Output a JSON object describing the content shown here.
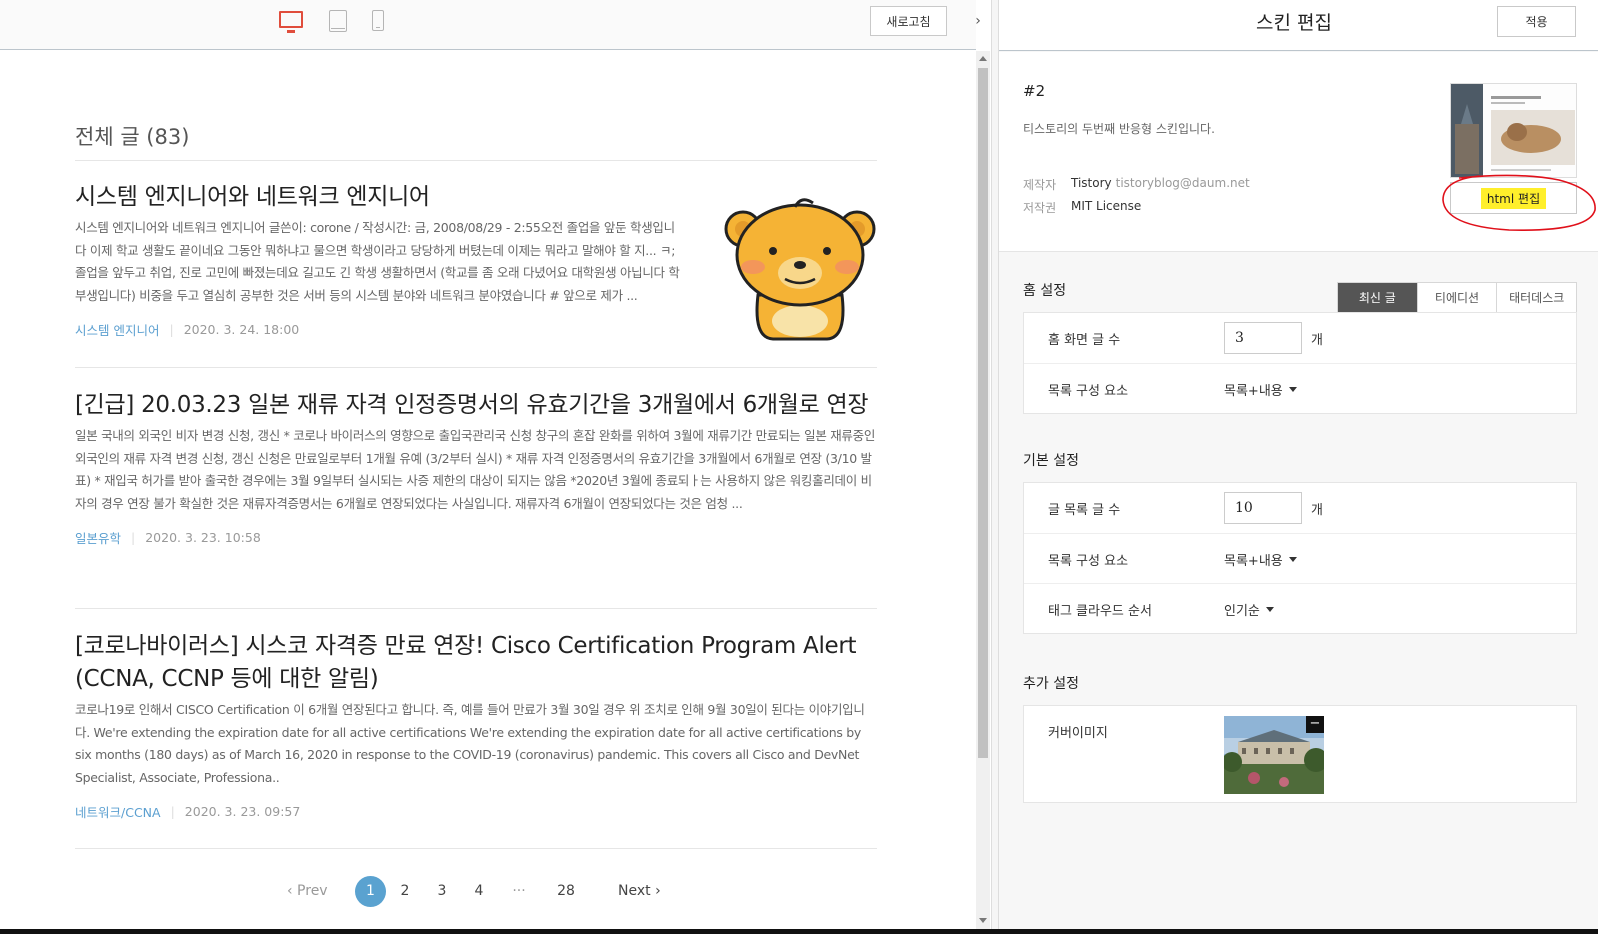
{
  "preview": {
    "toolbar": {
      "refresh_label": "새로고침",
      "collapse_glyph": "›"
    },
    "blog_title": "전체 글 (83)",
    "posts": [
      {
        "title": "시스템 엔지니어와 네트워크 엔지니어",
        "excerpt": "시스템 엔지니어와 네트워크 엔지니어 글쓴이: corone / 작성시간: 금, 2008/08/29 - 2:55오전 졸업을 앞둔 학생입니다 이제 학교 생활도 끝이네요 그동안 뭐하냐고 물으면 학생이라고 당당하게 버텼는데 이제는 뭐라고 말해야 할 지... ㅋ; 졸업을 앞두고 취업, 진로 고민에 빠졌는데요 길고도 긴 학생 생활하면서 (학교를 좀 오래 다녔어요 대학원생 아닙니다 학부생입니다) 비중을 두고 열심히 공부한 것은 서버 등의 시스템 분야와 네트워크 분야였습니다 # 앞으로 제가 ...",
        "category": "시스템 엔지니어",
        "date": "2020. 3. 24. 18:00"
      },
      {
        "title": "[긴급] 20.03.23 일본 재류 자격 인정증명서의 유효기간을 3개월에서 6개월로 연장",
        "excerpt": "일본 국내의 외국인 비자 변경 신청, 갱신 * 코로나 바이러스의 영향으로 출입국관리국 신청 창구의 혼잡 완화를 위하여 3월에 재류기간 만료되는 일본 재류중인 외국인의 재류 자격 변경 신청, 갱신 신청은 만료일로부터 1개월 유예 (3/2부터 실시) * 재류 자격 인정증명서의 유효기간을 3개월에서 6개월로 연장 (3/10 발표) * 재입국 허가를 받아 출국한 경우에는 3월 9일부터 실시되는 사증 제한의 대상이 되지는 않음 *2020년 3월에 종료되ㅏ는 사용하지 않은 워킹홀리데이 비자의 경우 연장 불가 확실한 것은 재류자격증명서는 6개월로 연장되었다는 사실입니다. 재류자격 6개월이 연장되었다는 것은 엄청 ...",
        "category": "일본유학",
        "date": "2020. 3. 23. 10:58"
      },
      {
        "title": "[코로나바이러스] 시스코 자격증 만료 연장! Cisco Certification Program Alert (CCNA, CCNP 등에 대한 알림)",
        "excerpt": "코로나19로 인해서 CISCO Certification 이 6개월 연장된다고 합니다. 즉, 예를 들어 만료가 3월 30일 경우 위 조치로 인해 9월 30일이 된다는 이야기입니다. We're extending the expiration date for all active certifications We're extending the expiration date for all active certifications by six months (180 days) as of March 16, 2020 in response to the COVID-19 (coronavirus) pandemic. This covers all Cisco and DevNet Specialist, Associate, Professiona..",
        "category": "네트워크/CCNA",
        "date": "2020. 3. 23. 09:57"
      }
    ],
    "pagination": {
      "prev": "‹ Prev",
      "next": "Next ›",
      "pages": [
        "1",
        "2",
        "3",
        "4",
        "···",
        "28"
      ],
      "current": "1"
    }
  },
  "editor": {
    "title": "스킨 편집",
    "apply_label": "적용",
    "skin": {
      "name": "#2",
      "description": "티스토리의 두번째 반응형 스킨입니다.",
      "maker_label": "제작자",
      "maker_name": "Tistory",
      "maker_email": "tistoryblog@daum.net",
      "license_label": "저작권",
      "license_value": "MIT License",
      "html_edit_label": "html 편집"
    },
    "home": {
      "title": "홈 설정",
      "tabs": [
        "최신 글",
        "티에디션",
        "태터데스크"
      ],
      "active_tab": "최신 글",
      "post_count_label": "홈 화면 글 수",
      "post_count_value": "3",
      "unit": "개",
      "list_label": "목록 구성 요소",
      "list_value": "목록+내용"
    },
    "basic": {
      "title": "기본 설정",
      "list_count_label": "글 목록 글 수",
      "list_count_value": "10",
      "unit": "개",
      "list_label": "목록 구성 요소",
      "list_value": "목록+내용",
      "tag_label": "태그 클라우드 순서",
      "tag_value": "인기순"
    },
    "extra": {
      "title": "추가 설정",
      "cover_label": "커버이미지",
      "remove_glyph": "−"
    }
  },
  "colors": {
    "accent_blue": "#5aa2d0",
    "device_active": "#e04d3c",
    "highlight": "#ffef2b",
    "annotation": "#e0101a"
  }
}
